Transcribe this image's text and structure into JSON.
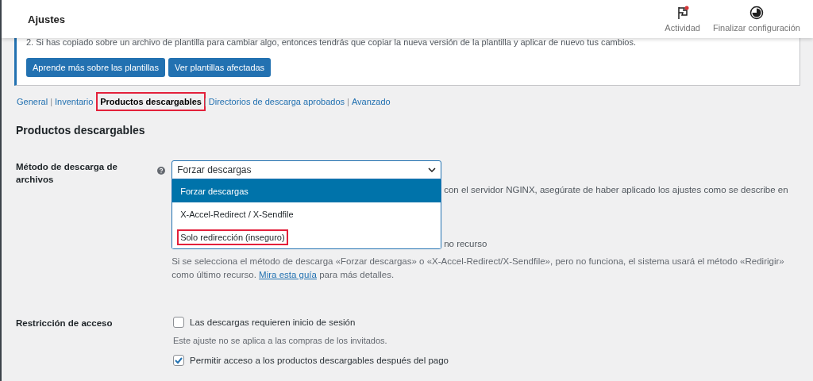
{
  "header": {
    "title": "Ajustes",
    "actions": [
      {
        "label": "Actividad",
        "kind": "flag",
        "badge": true
      },
      {
        "label": "Finalizar configuración",
        "kind": "progress",
        "badge": false
      }
    ]
  },
  "notice": {
    "text": "2. Si has copiado sobre un archivo de plantilla para cambiar algo, entonces tendrás que copiar la nueva versión de la plantilla y aplicar de nuevo tus cambios.",
    "buttons": [
      "Aprende más sobre las plantillas",
      "Ver plantillas afectadas"
    ]
  },
  "subnav_separator": "|",
  "subnav": [
    {
      "label": "General",
      "selected": false,
      "highlighted": false
    },
    {
      "label": "Inventario",
      "selected": false,
      "highlighted": false
    },
    {
      "label": "Productos descargables",
      "selected": true,
      "highlighted": true
    },
    {
      "label": "Directorios de descarga aprobados",
      "selected": false,
      "highlighted": false
    },
    {
      "label": "Avanzado",
      "selected": false,
      "highlighted": false
    }
  ],
  "section_title": "Productos descargables",
  "method": {
    "label": "Método de descarga de archivos",
    "value": "Forzar descargas",
    "expanded": true,
    "options": [
      {
        "label": "Forzar descargas",
        "selected": true,
        "highlighted": false
      },
      {
        "label": "X-Accel-Redirect / X-Sendfile",
        "selected": false,
        "highlighted": false
      },
      {
        "label": "Solo redirección (inseguro)",
        "selected": false,
        "highlighted": true
      }
    ],
    "hint_fragment": "con el servidor NGINX, asegúrate de haber aplicado los ajustes como se describe en",
    "option_fragment": "no recurso",
    "description": "Si se selecciona el método de descarga «Forzar descargas» o «X-Accel-Redirect/X-Sendfile», pero no funciona, el sistema usará el método «Redirigir» como último recurso.",
    "link": "Mira esta guía",
    "description_end": "para más detalles."
  },
  "access": {
    "label": "Restricción de acceso",
    "options": [
      {
        "label": "Las descargas requieren inicio de sesión",
        "checked": false,
        "note": "Este ajuste no se aplica a las compras de los invitados."
      },
      {
        "label": "Permitir acceso a los productos descargables después del pago",
        "checked": true
      }
    ]
  }
}
